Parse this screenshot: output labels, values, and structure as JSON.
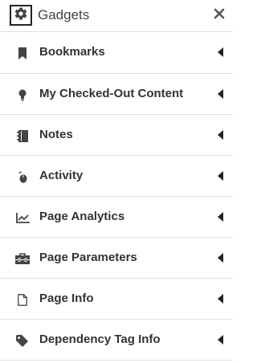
{
  "header": {
    "title": "Gadgets",
    "settings_icon": "gear-icon",
    "close_icon": "close-icon"
  },
  "items": [
    {
      "label": "Bookmarks",
      "icon": "bookmark-icon"
    },
    {
      "label": "My Checked-Out Content",
      "icon": "lightbulb-icon"
    },
    {
      "label": "Notes",
      "icon": "notebook-icon"
    },
    {
      "label": "Activity",
      "icon": "mouse-icon"
    },
    {
      "label": "Page Analytics",
      "icon": "line-chart-icon"
    },
    {
      "label": "Page Parameters",
      "icon": "toolbox-icon"
    },
    {
      "label": "Page Info",
      "icon": "file-icon"
    },
    {
      "label": "Dependency Tag Info",
      "icon": "tag-icon"
    }
  ],
  "colors": {
    "text": "#333333",
    "divider": "#e2e2e2",
    "icon": "#444444"
  }
}
